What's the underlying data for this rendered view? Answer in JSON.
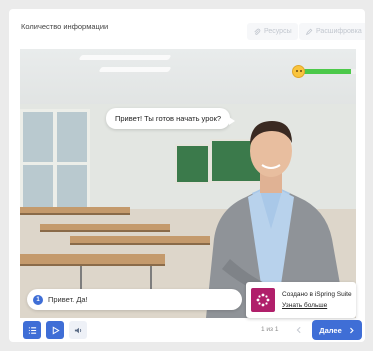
{
  "header": {
    "title": "Количество информации",
    "resources_label": "Ресурсы",
    "transcript_label": "Расшифровка"
  },
  "scene": {
    "speech": "Привет! Ты готов начать урок?",
    "mood_level": 0.9,
    "answer_number": "1",
    "answer_text": "Привет. Да!"
  },
  "branding": {
    "created_text": "Создано в iSpring Suite",
    "learn_more": "Узнать больше"
  },
  "footer": {
    "pages": "1 из 1",
    "next_label": "Далее"
  },
  "colors": {
    "accent": "#3f6ed6",
    "meter": "#4cc94a",
    "brand": "#b01f6a"
  }
}
